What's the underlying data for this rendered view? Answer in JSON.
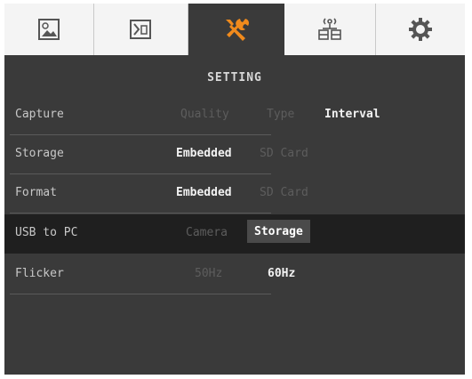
{
  "tabs": [
    {
      "icon": "image-capture-icon"
    },
    {
      "icon": "video-playback-icon"
    },
    {
      "icon": "tools-icon",
      "active": true
    },
    {
      "icon": "network-icon"
    },
    {
      "icon": "gear-icon"
    }
  ],
  "accent_color": "#f08a1c",
  "title": "SETTING",
  "rows": {
    "capture": {
      "label": "Capture",
      "options": [
        "Quality",
        "Type",
        "Interval"
      ],
      "selected": "Interval"
    },
    "storage": {
      "label": "Storage",
      "options": [
        "Embedded",
        "SD Card"
      ],
      "selected": "Embedded"
    },
    "format": {
      "label": "Format",
      "options": [
        "Embedded",
        "SD Card"
      ],
      "selected": "Embedded"
    },
    "usb": {
      "label": "USB to PC",
      "options": [
        "Camera",
        "Storage"
      ],
      "selected": "Storage"
    },
    "flicker": {
      "label": "Flicker",
      "options": [
        "50Hz",
        "60Hz"
      ],
      "selected": "60Hz"
    }
  }
}
